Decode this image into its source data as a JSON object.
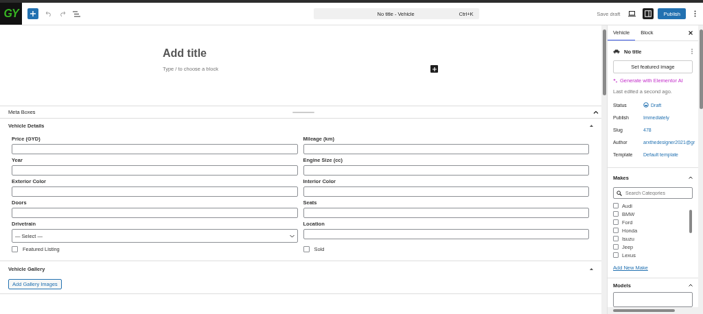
{
  "logo": {
    "text": "GY"
  },
  "toolbar": {
    "document_title": "No title - Vehicle",
    "shortcut": "Ctrl+K",
    "save_draft": "Save draft",
    "publish": "Publish",
    "settings_open": true
  },
  "editor": {
    "title_placeholder": "Add title",
    "block_placeholder": "Type / to choose a block"
  },
  "meta_boxes": {
    "label": "Meta Boxes"
  },
  "vehicle_details": {
    "title": "Vehicle Details",
    "fields": [
      {
        "label": "Price (GYD)",
        "kind": "text"
      },
      {
        "label": "Mileage (km)",
        "kind": "text"
      },
      {
        "label": "Year",
        "kind": "text"
      },
      {
        "label": "Engine Size (cc)",
        "kind": "text"
      },
      {
        "label": "Exterior Color",
        "kind": "text"
      },
      {
        "label": "Interior Color",
        "kind": "text"
      },
      {
        "label": "Doors",
        "kind": "text"
      },
      {
        "label": "Seats",
        "kind": "text"
      },
      {
        "label": "Drivetrain",
        "kind": "select",
        "value": "— Select —"
      },
      {
        "label": "Location",
        "kind": "text"
      }
    ],
    "checkboxes": [
      {
        "label": "Featured Listing",
        "checked": false
      },
      {
        "label": "Sold",
        "checked": false
      }
    ]
  },
  "vehicle_gallery": {
    "title": "Vehicle Gallery",
    "button": "Add Gallery Images"
  },
  "sidebar": {
    "tabs": [
      {
        "label": "Vehicle",
        "selected": true
      },
      {
        "label": "Block",
        "selected": false
      }
    ],
    "post_title": "No title",
    "featured_image_button": "Set featured image",
    "ai_link": "Generate with Elementor AI",
    "last_edited": "Last edited a second ago.",
    "rows": [
      {
        "label": "Status",
        "value": "Draft",
        "kind": "status"
      },
      {
        "label": "Publish",
        "value": "Immediately",
        "kind": "link"
      },
      {
        "label": "Slug",
        "value": "478",
        "kind": "link"
      },
      {
        "label": "Author",
        "value": "arxthedesigner2021@gr",
        "kind": "link"
      },
      {
        "label": "Template",
        "value": "Default template",
        "kind": "link"
      }
    ],
    "makes": {
      "title": "Makes",
      "search_placeholder": "Search Categories",
      "items": [
        {
          "label": "Audi",
          "checked": false
        },
        {
          "label": "BMW",
          "checked": false
        },
        {
          "label": "Ford",
          "checked": false
        },
        {
          "label": "Honda",
          "checked": false
        },
        {
          "label": "Isuzu",
          "checked": false
        },
        {
          "label": "Jeep",
          "checked": false
        },
        {
          "label": "Lexus",
          "checked": false
        }
      ],
      "add_link": "Add New Make"
    },
    "models": {
      "title": "Models"
    }
  }
}
